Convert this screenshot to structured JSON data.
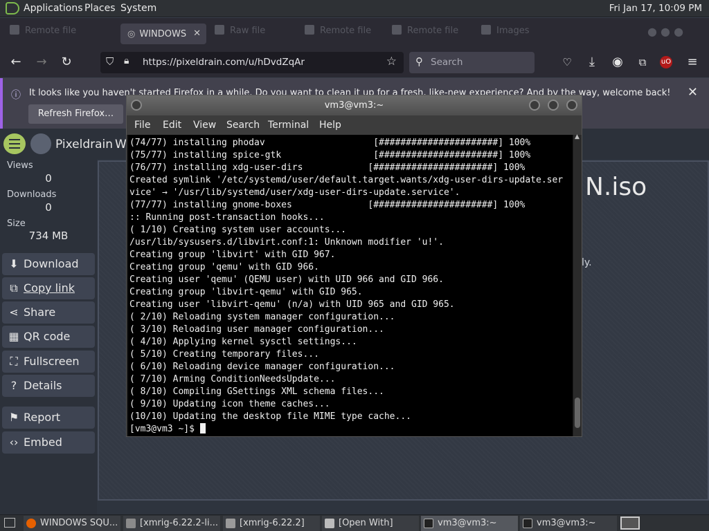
{
  "top_panel": {
    "menus": [
      "Applications",
      "Places",
      "System"
    ],
    "clock": "Fri Jan 17, 10:09 PM"
  },
  "browser": {
    "tabs": [
      {
        "label": "WINDOWS"
      },
      {
        "label": "Raw file"
      },
      {
        "label": "Remote file"
      },
      {
        "label": "Remote file"
      },
      {
        "label": "Images"
      }
    ],
    "active_tab": "WINDOWS",
    "url": "https://pixeldrain.com/u/hDvdZqAr",
    "search_placeholder": "Search"
  },
  "notification": {
    "text": "It looks like you haven't started Firefox in a while. Do you want to clean it up for a fresh, like-new experience? And by the way, welcome back!",
    "button": "Refresh Firefox…"
  },
  "pixeldrain": {
    "site_name": "Pixeldrain",
    "title_prefix": "W",
    "title_suffix": "N.iso",
    "right_text": "ly.",
    "stats": [
      {
        "label": "Views",
        "value": "0"
      },
      {
        "label": "Downloads",
        "value": "0"
      },
      {
        "label": "Size",
        "value": "734 MB"
      }
    ],
    "buttons": [
      {
        "label": "Download",
        "icon": "download-icon"
      },
      {
        "label": "Copy link",
        "icon": "copy-icon"
      },
      {
        "label": "Share",
        "icon": "share-icon"
      },
      {
        "label": "QR code",
        "icon": "qr-icon"
      },
      {
        "label": "Fullscreen",
        "icon": "fullscreen-icon"
      },
      {
        "label": "Details",
        "icon": "help-icon"
      },
      {
        "label": "Report",
        "icon": "flag-icon"
      },
      {
        "label": "Embed",
        "icon": "code-icon"
      }
    ]
  },
  "terminal": {
    "title": "vm3@vm3:~",
    "menus": [
      "File",
      "Edit",
      "View",
      "Search",
      "Terminal",
      "Help"
    ],
    "lines": [
      "(74/77) installing phodav                    [######################] 100%",
      "(75/77) installing spice-gtk                 [######################] 100%",
      "(76/77) installing xdg-user-dirs            [######################] 100%",
      "Created symlink '/etc/systemd/user/default.target.wants/xdg-user-dirs-update.ser",
      "vice' → '/usr/lib/systemd/user/xdg-user-dirs-update.service'.",
      "(77/77) installing gnome-boxes              [######################] 100%",
      ":: Running post-transaction hooks...",
      "( 1/10) Creating system user accounts...",
      "/usr/lib/sysusers.d/libvirt.conf:1: Unknown modifier 'u!'.",
      "Creating group 'libvirt' with GID 967.",
      "Creating group 'qemu' with GID 966.",
      "Creating user 'qemu' (QEMU user) with UID 966 and GID 966.",
      "Creating group 'libvirt-qemu' with GID 965.",
      "Creating user 'libvirt-qemu' (n/a) with UID 965 and GID 965.",
      "( 2/10) Reloading system manager configuration...",
      "( 3/10) Reloading user manager configuration...",
      "( 4/10) Applying kernel sysctl settings...",
      "( 5/10) Creating temporary files...",
      "( 6/10) Reloading device manager configuration...",
      "( 7/10) Arming ConditionNeedsUpdate...",
      "( 8/10) Compiling GSettings XML schema files...",
      "( 9/10) Updating icon theme caches...",
      "(10/10) Updating the desktop file MIME type cache..."
    ],
    "prompt": "[vm3@vm3 ~]$ "
  },
  "taskbar": {
    "items": [
      {
        "label": "WINDOWS SQU...",
        "icon": "firefox-icon"
      },
      {
        "label": "[xmrig-6.22.2-li...",
        "icon": "archive-icon"
      },
      {
        "label": "[xmrig-6.22.2]",
        "icon": "folder-icon"
      },
      {
        "label": "[Open With]",
        "icon": "dialog-icon"
      },
      {
        "label": "vm3@vm3:~",
        "icon": "terminal-icon"
      },
      {
        "label": "vm3@vm3:~",
        "icon": "terminal-icon"
      }
    ]
  },
  "colors": {
    "accent_green": "#a7c660",
    "notification_accent": "#9e62e6"
  }
}
